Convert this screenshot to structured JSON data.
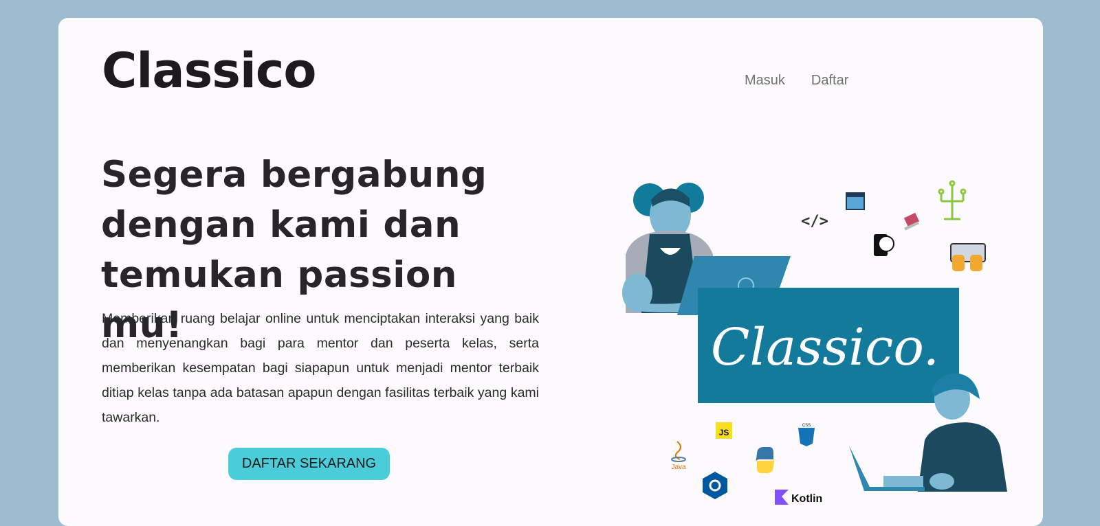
{
  "header": {
    "brand": "Classico",
    "nav": [
      {
        "label": "Masuk"
      },
      {
        "label": "Daftar"
      }
    ]
  },
  "hero": {
    "headline_lines": [
      "Segera bergabung",
      "dengan kami dan",
      "temukan passion mu!"
    ],
    "description": "Memberikan ruang belajar online untuk menciptakan interaksi yang baik dan menyenangkan bagi para mentor dan peserta kelas, serta memberikan kesempatan bagi siapapun untuk menjadi mentor terbaik ditiap kelas tanpa ada batasan apapun dengan fasilitas terbaik yang kami tawarkan.",
    "cta_label": "DAFTAR SEKARANG"
  },
  "illustration": {
    "banner_text": "Classico.",
    "tech_labels": {
      "js": "JS",
      "css": "CSS",
      "java": "Java",
      "kotlin": "Kotlin",
      "code_tag": "</>"
    }
  },
  "colors": {
    "page_bg": "#9dbcd0",
    "card_bg": "#fdfafd",
    "cta_bg": "#4bcdd9",
    "banner_bg": "#137a9c"
  }
}
